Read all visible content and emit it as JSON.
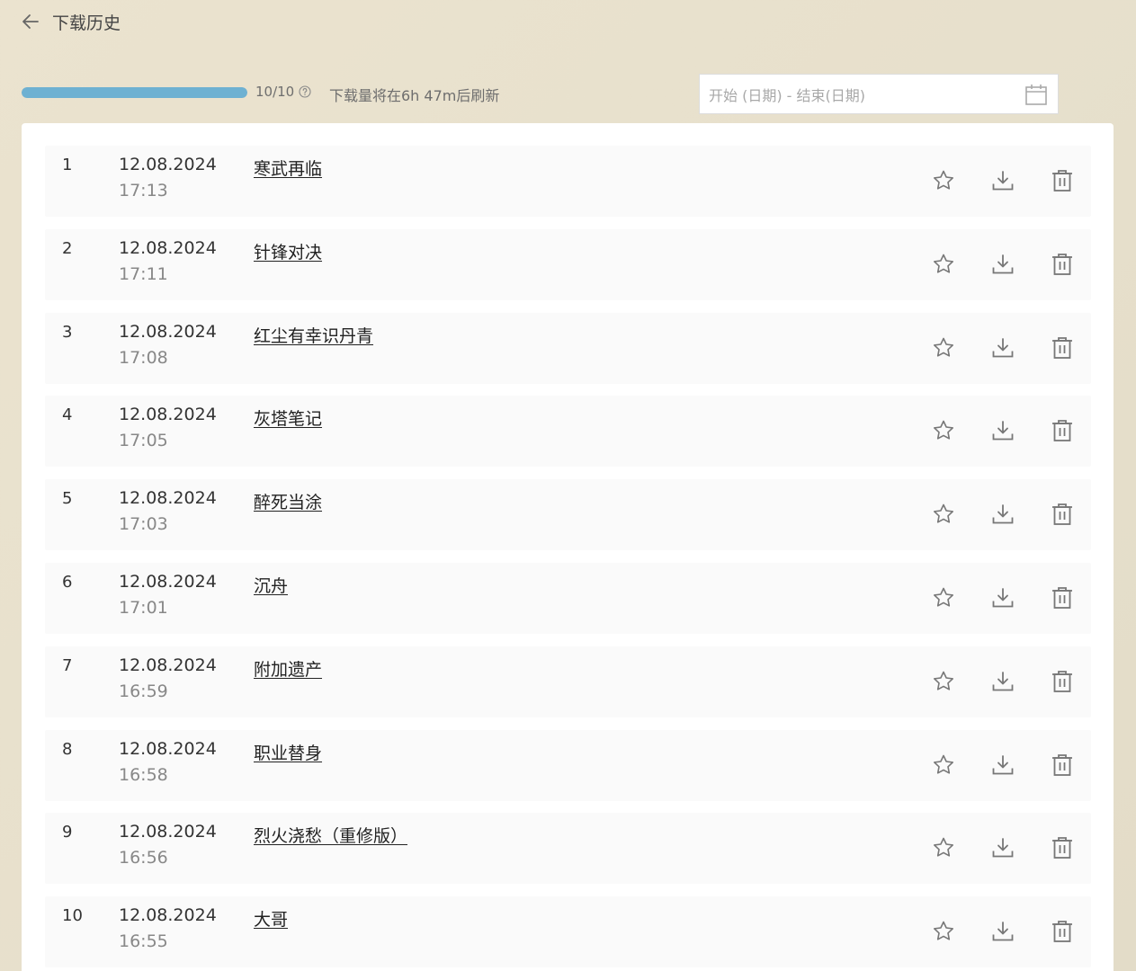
{
  "header": {
    "title": "下载历史",
    "back_icon": "arrow-left-icon"
  },
  "quota": {
    "text": "10/10",
    "fill_fraction": 1.0,
    "refresh_text": "下载量将在6h 47m后刷新",
    "bar_color": "#6eb1d2"
  },
  "date_range": {
    "placeholder": "开始 (日期) - 结束(日期)"
  },
  "rows": [
    {
      "index": "1",
      "date": "12.08.2024",
      "time": "17:13",
      "title": "寒武再临"
    },
    {
      "index": "2",
      "date": "12.08.2024",
      "time": "17:11",
      "title": "针锋对决"
    },
    {
      "index": "3",
      "date": "12.08.2024",
      "time": "17:08",
      "title": "红尘有幸识丹青"
    },
    {
      "index": "4",
      "date": "12.08.2024",
      "time": "17:05",
      "title": "灰塔笔记"
    },
    {
      "index": "5",
      "date": "12.08.2024",
      "time": "17:03",
      "title": "醉死当涂"
    },
    {
      "index": "6",
      "date": "12.08.2024",
      "time": "17:01",
      "title": "沉舟"
    },
    {
      "index": "7",
      "date": "12.08.2024",
      "time": "16:59",
      "title": "附加遗产"
    },
    {
      "index": "8",
      "date": "12.08.2024",
      "time": "16:58",
      "title": "职业替身"
    },
    {
      "index": "9",
      "date": "12.08.2024",
      "time": "16:56",
      "title": "烈火浇愁（重修版）"
    },
    {
      "index": "10",
      "date": "12.08.2024",
      "time": "16:55",
      "title": "大哥"
    }
  ],
  "row_icons": [
    "star-icon",
    "download-icon",
    "trash-icon"
  ]
}
